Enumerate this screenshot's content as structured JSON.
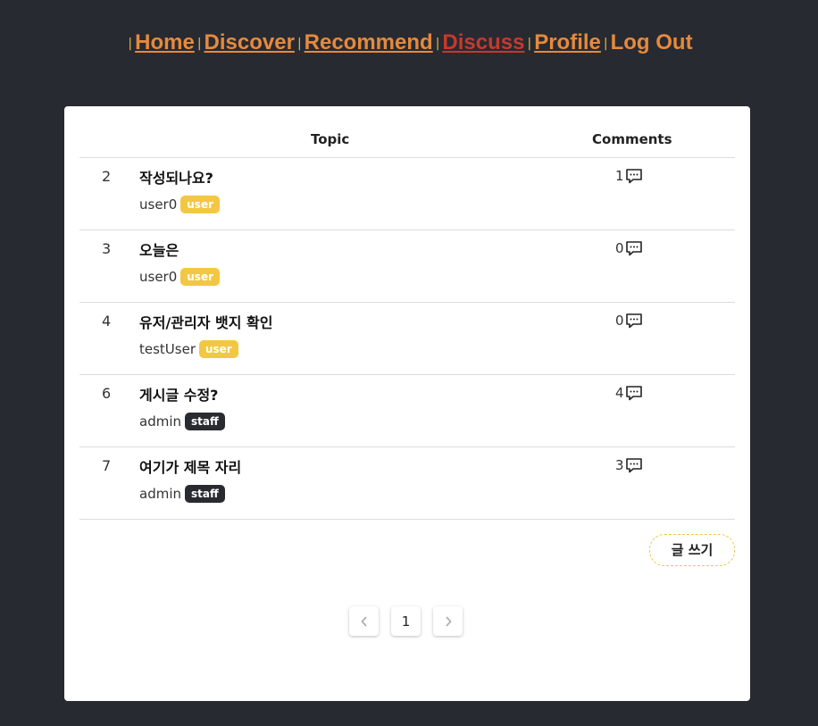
{
  "nav": {
    "separator": "|",
    "home": "Home",
    "discover": "Discover",
    "recommend": "Recommend",
    "discuss": "Discuss",
    "profile": "Profile",
    "logout": "Log Out",
    "active": "Discuss"
  },
  "table": {
    "headers": {
      "topic": "Topic",
      "comments": "Comments"
    },
    "rows": [
      {
        "num": "2",
        "title": "작성되나요?",
        "author": "user0",
        "role": "user",
        "comments": "1"
      },
      {
        "num": "3",
        "title": "오늘은",
        "author": "user0",
        "role": "user",
        "comments": "0"
      },
      {
        "num": "4",
        "title": "유저/관리자 뱃지 확인",
        "author": "testUser",
        "role": "user",
        "comments": "0"
      },
      {
        "num": "6",
        "title": "게시글 수정?",
        "author": "admin",
        "role": "staff",
        "comments": "4"
      },
      {
        "num": "7",
        "title": "여기가 제목 자리",
        "author": "admin",
        "role": "staff",
        "comments": "3"
      }
    ]
  },
  "write_button": "글 쓰기",
  "pagination": {
    "current_page": "1",
    "prev_icon": "chevron-left-icon",
    "next_icon": "chevron-right-icon"
  },
  "colors": {
    "background": "#282a31",
    "nav_link": "#e58a3d",
    "nav_active": "#c43a2c",
    "badge_user": "#f2c744",
    "badge_staff": "#2a2b31"
  }
}
